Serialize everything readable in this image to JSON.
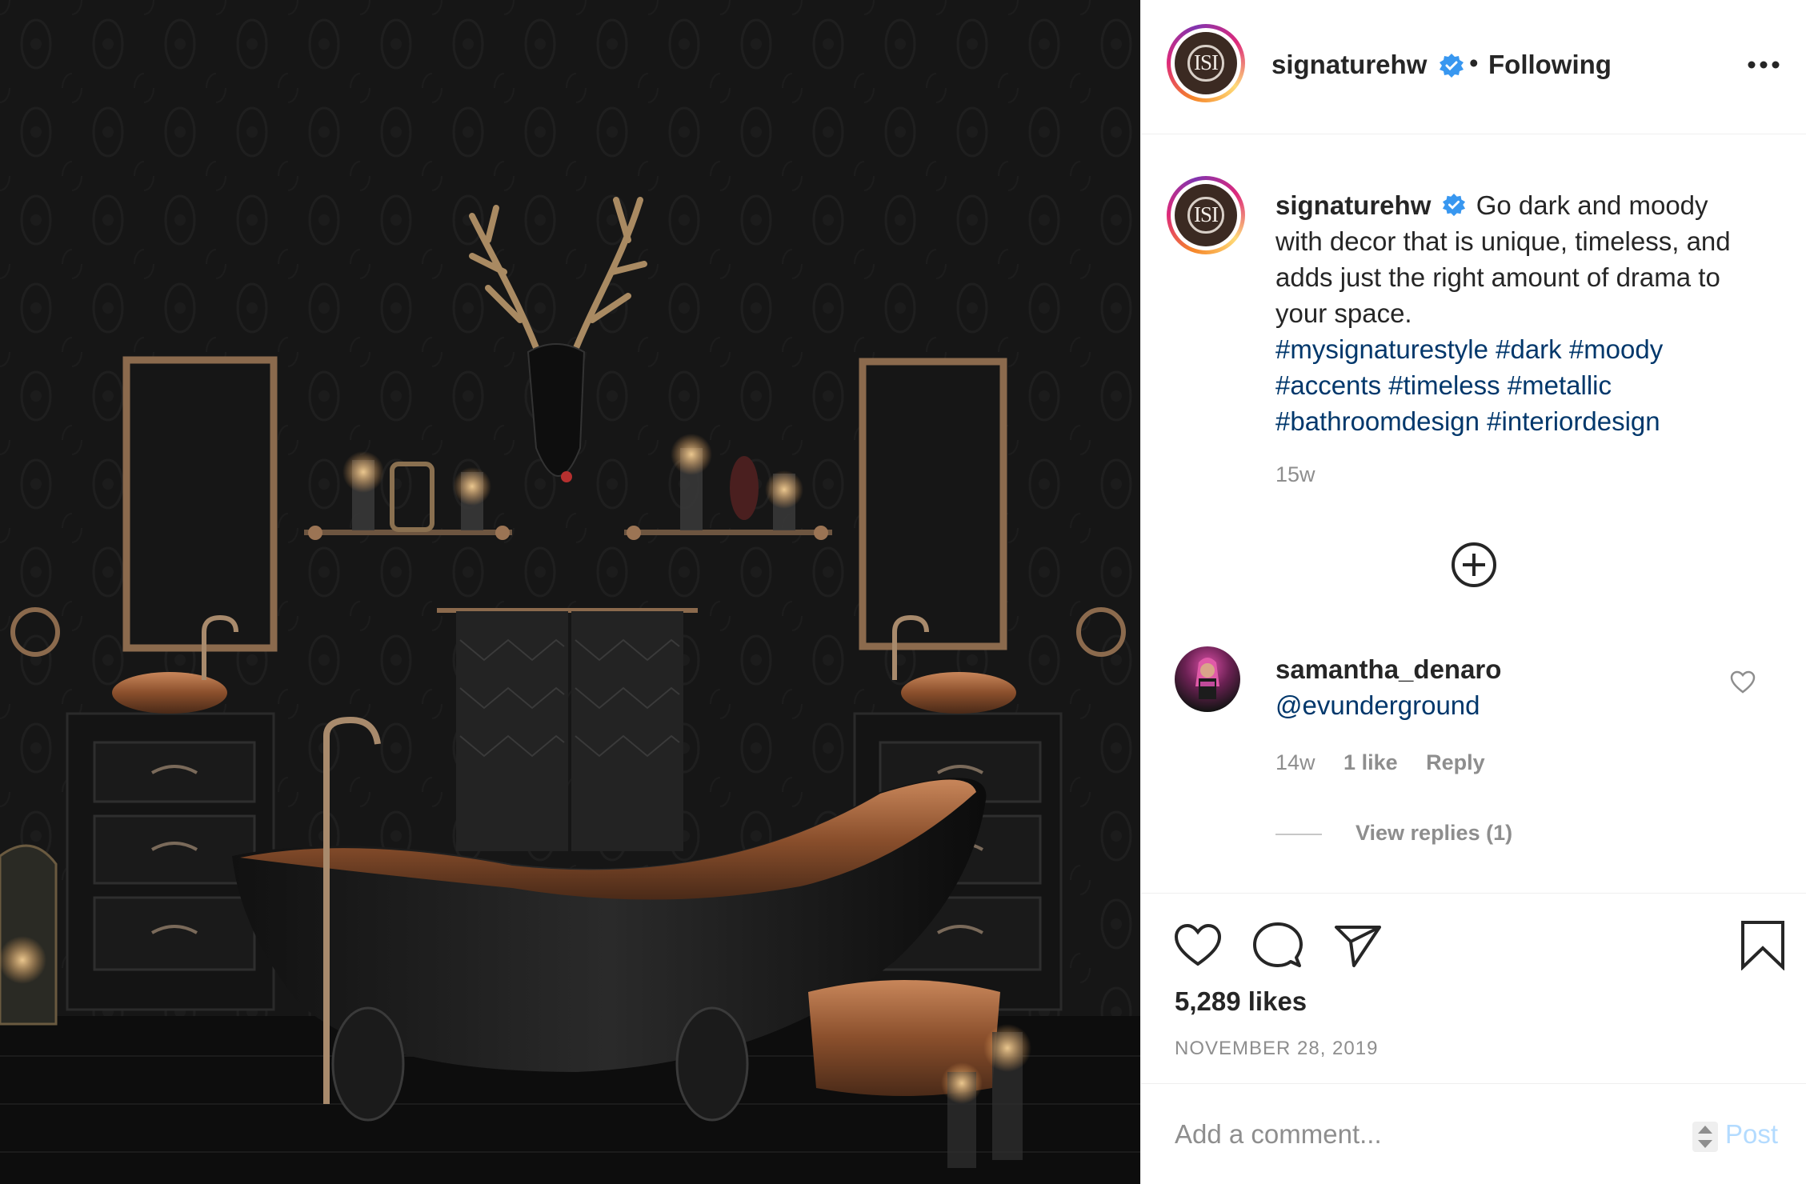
{
  "post": {
    "username": "signaturehw",
    "follow_status": "Following",
    "avatar_letters": "ISI",
    "caption": "Go dark and moody with decor that is unique, timeless, and adds just the right amount of drama to your space.",
    "hashtags": "#mysignaturestyle #dark #moody #accents #timeless #metallic #bathroomdesign #interiordesign",
    "caption_time": "15w",
    "likes": "5,289 likes",
    "date": "NOVEMBER 28, 2019"
  },
  "comment": {
    "username": "samantha_denaro",
    "text": "@evunderground",
    "time": "14w",
    "likes": "1 like",
    "reply": "Reply",
    "view_replies": "View replies (1)"
  },
  "comment_box": {
    "placeholder": "Add a comment...",
    "post_label": "Post"
  },
  "colors": {
    "link": "#00376b",
    "verified": "#3897f0",
    "post_disabled": "#b3dbff"
  },
  "icons": [
    "more-icon",
    "verified-icon",
    "load-more-icon",
    "heart-icon",
    "comment-icon",
    "share-icon",
    "bookmark-icon"
  ]
}
